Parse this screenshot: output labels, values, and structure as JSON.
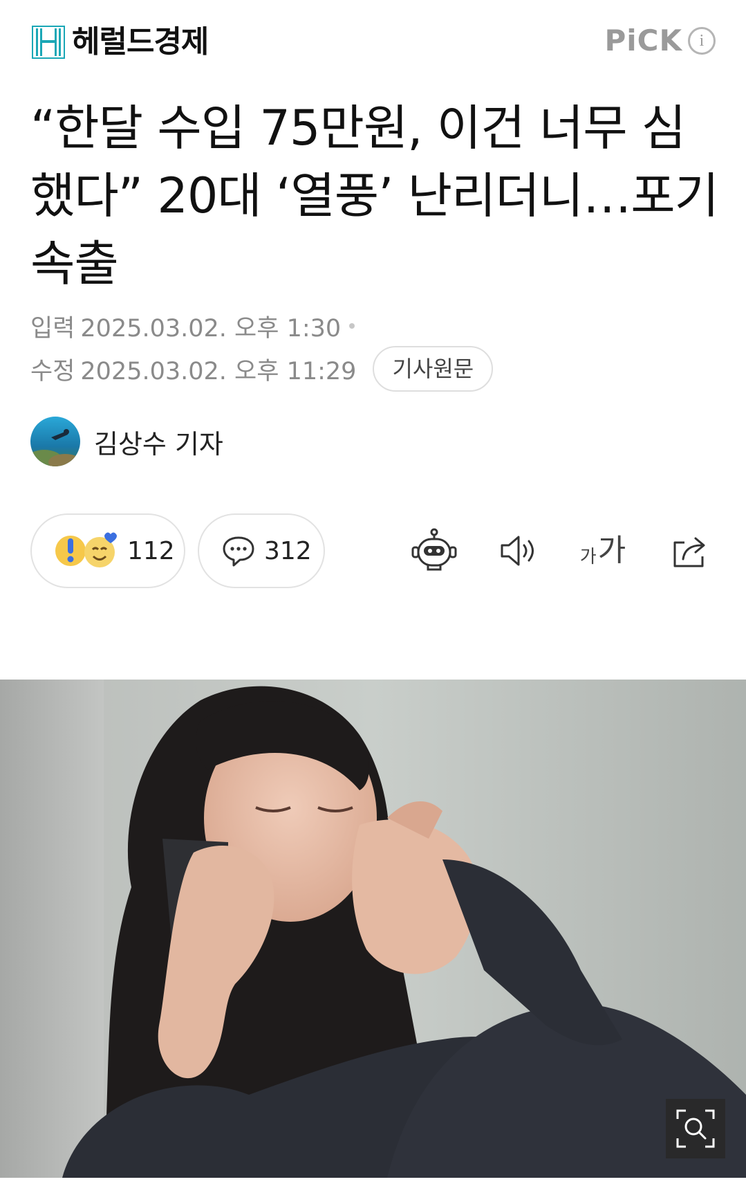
{
  "header": {
    "brand": "헤럴드경제",
    "pick_label": "PiCK",
    "info_glyph": "i"
  },
  "article": {
    "headline": "“한달 수입 75만원, 이건 너무 심했다” 20대 ‘열풍’ 난리더니…포기 속출",
    "published_label": "입력",
    "published_time": "2025.03.02. 오후 1:30",
    "modified_label": "수정",
    "modified_time": "2025.03.02. 오후 11:29",
    "original_button": "기사원문"
  },
  "reporter": {
    "name": "김상수 기자"
  },
  "actions": {
    "reaction_count": "112",
    "comment_count": "312",
    "font_small": "가",
    "font_big": "가"
  },
  "icons": {
    "logo": "herald-logo-icon",
    "robot": "summary-bot-icon",
    "speaker": "speaker-icon",
    "share": "share-icon",
    "comment": "speech-bubble-icon",
    "zoom": "zoom-icon"
  },
  "colors": {
    "brand_teal": "#1aa7b6",
    "meta_gray": "#8a8a8a",
    "pick_gray": "#9a9a9a"
  }
}
